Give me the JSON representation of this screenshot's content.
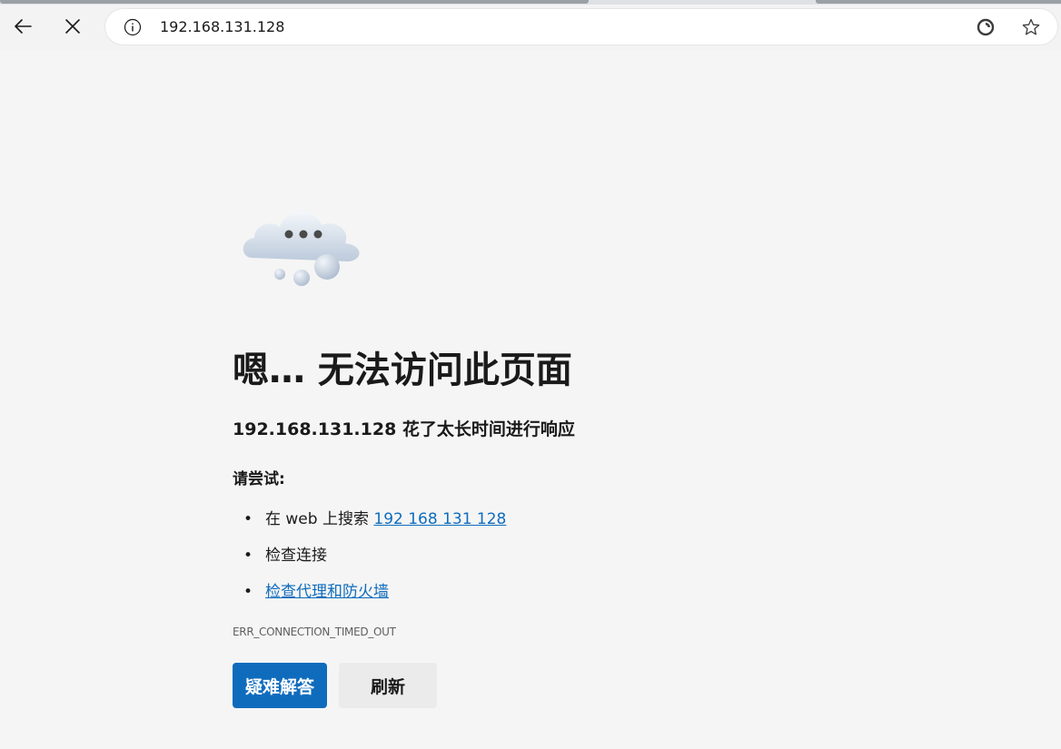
{
  "browser": {
    "url": "192.168.131.128",
    "icons": {
      "back": "back-arrow-icon",
      "stop": "close-icon",
      "info": "info-icon",
      "read_aloud": "edge-refresh-icon",
      "favorite": "star-icon"
    }
  },
  "error_page": {
    "illustration": "cloud-icon",
    "title": "嗯… 无法访问此页面",
    "subtitle": "192.168.131.128 花了太长时间进行响应",
    "try_label": "请尝试:",
    "suggestions": [
      {
        "prefix": "在 web 上搜索 ",
        "link": "192 168 131 128"
      },
      {
        "text": "检查连接"
      },
      {
        "link": "检查代理和防火墙"
      }
    ],
    "error_code": "ERR_CONNECTION_TIMED_OUT",
    "buttons": {
      "primary": "疑难解答",
      "secondary": "刷新"
    }
  },
  "colors": {
    "accent": "#0f6cbd",
    "background": "#f5f5f5"
  }
}
